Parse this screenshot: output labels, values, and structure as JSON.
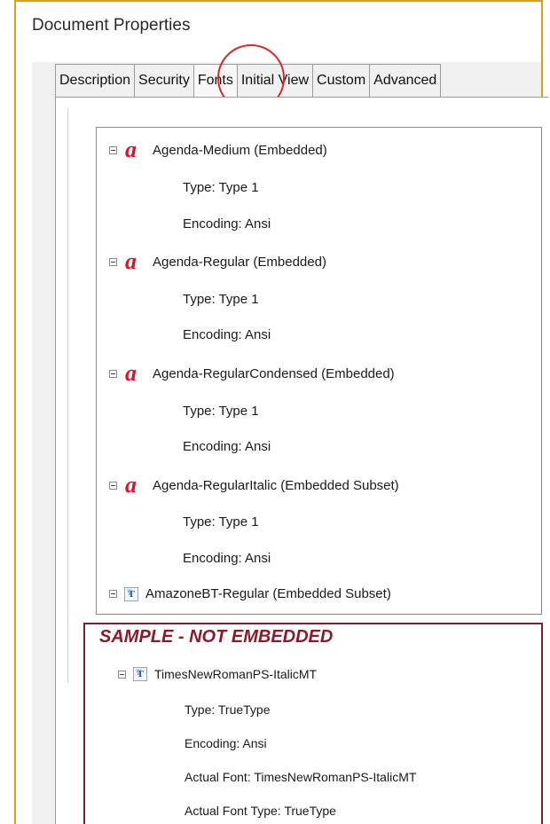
{
  "window": {
    "title": "Document Properties"
  },
  "tabs": [
    {
      "label": "Description"
    },
    {
      "label": "Security"
    },
    {
      "label": "Fonts"
    },
    {
      "label": "Initial View"
    },
    {
      "label": "Custom"
    },
    {
      "label": "Advanced"
    }
  ],
  "active_tab": "Fonts",
  "fonts": [
    {
      "name": "Agenda-Medium (Embedded)",
      "icon": "type1-font-icon",
      "type": "Type: Type 1",
      "encoding": "Encoding: Ansi"
    },
    {
      "name": "Agenda-Regular (Embedded)",
      "icon": "type1-font-icon",
      "type": "Type: Type 1",
      "encoding": "Encoding: Ansi"
    },
    {
      "name": "Agenda-RegularCondensed (Embedded)",
      "icon": "type1-font-icon",
      "type": "Type: Type 1",
      "encoding": "Encoding: Ansi"
    },
    {
      "name": "Agenda-RegularItalic (Embedded Subset)",
      "icon": "type1-font-icon",
      "type": "Type: Type 1",
      "encoding": "Encoding: Ansi"
    },
    {
      "name": "AmazoneBT-Regular (Embedded Subset)",
      "icon": "truetype-font-icon"
    }
  ],
  "sample": {
    "title": "SAMPLE -  NOT EMBEDDED",
    "font_name": "TimesNewRomanPS-ItalicMT",
    "icon": "truetype-font-icon",
    "type": "Type: TrueType",
    "encoding": "Encoding: Ansi",
    "actual_font": "Actual Font: TimesNewRomanPS-ItalicMT",
    "actual_font_type": "Actual Font Type: TrueType"
  },
  "colors": {
    "frame_border": "#d9a020",
    "highlight_circle": "#d42a2a",
    "sample_border": "#7a2030",
    "sample_title": "#8b1a2b",
    "type1_icon": "#d6152a"
  }
}
